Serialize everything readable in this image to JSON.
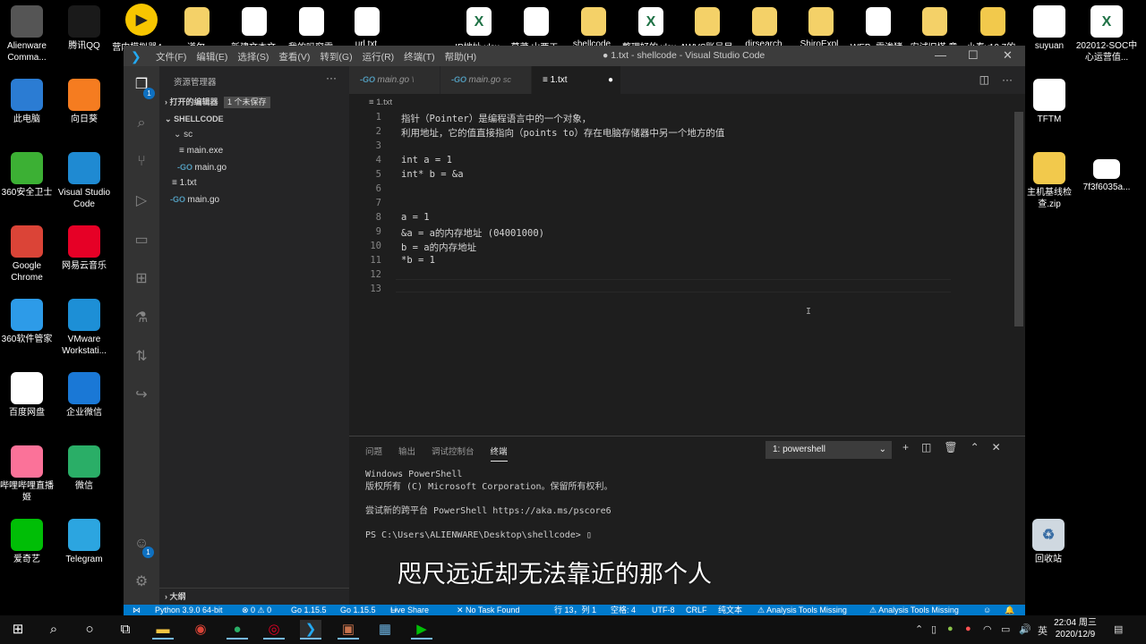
{
  "desktop": {
    "top_labels": [
      "营内模拟器4",
      "道尔",
      "新建文本文",
      "我的吗窗需",
      "url.txt",
      "IP地址.xlsx",
      "草莽 山两工",
      "shellcode",
      "整理好的.xlsx",
      "AWVS账号目",
      "dirsearch",
      "ShiroExpl",
      "WEB_需渗猪",
      "安试旧塔 意",
      "小泰v10.7的"
    ],
    "left_icons": [
      {
        "label": "Alienware Comma...",
        "icon": "alien-icon",
        "color": "#555"
      },
      {
        "label": "腾讯QQ",
        "icon": "qq-icon",
        "color": "#1a1a1a"
      },
      {
        "label": "此电脑",
        "icon": "computer-icon",
        "color": "#2b7cd3"
      },
      {
        "label": "向日葵",
        "icon": "sunflower-icon",
        "color": "#f57c20"
      },
      {
        "label": "360安全卫士",
        "icon": "360-icon",
        "color": "#3cb034"
      },
      {
        "label": "Visual Studio Code",
        "icon": "vscode-icon",
        "color": "#1f8ad2"
      },
      {
        "label": "Google Chrome",
        "icon": "chrome-icon",
        "color": "#db4437"
      },
      {
        "label": "网易云音乐",
        "icon": "netease-icon",
        "color": "#e60026"
      },
      {
        "label": "360软件管家",
        "icon": "360soft-icon",
        "color": "#2d9be8"
      },
      {
        "label": "VMware Workstati...",
        "icon": "vmware-icon",
        "color": "#1d8fd6"
      },
      {
        "label": "百度网盘",
        "icon": "baidu-icon",
        "color": "#fff"
      },
      {
        "label": "企业微信",
        "icon": "wecom-icon",
        "color": "#1a78d6"
      },
      {
        "label": "哔哩哔哩直播姬",
        "icon": "bilibili-icon",
        "color": "#fb7299"
      },
      {
        "label": "微信",
        "icon": "wechat-icon",
        "color": "#2aae67"
      },
      {
        "label": "爱奇艺",
        "icon": "iqiyi-icon",
        "color": "#00be06"
      },
      {
        "label": "Telegram",
        "icon": "telegram-icon",
        "color": "#2ca5e0"
      }
    ],
    "right_icons": [
      {
        "label": "suyuan",
        "icon": "word-icon"
      },
      {
        "label": "202012-SOC中心运营值...",
        "icon": "excel-icon"
      },
      {
        "label": "TFTM",
        "icon": "word-icon"
      },
      {
        "label": "主机基线检查.zip",
        "icon": "zip-icon"
      },
      {
        "label": "7f3f6035a...",
        "icon": "file-icon"
      },
      {
        "label": "回收站",
        "icon": "recycle-bin-icon"
      }
    ]
  },
  "window": {
    "menu": [
      "文件(F)",
      "编辑(E)",
      "选择(S)",
      "查看(V)",
      "转到(G)",
      "运行(R)",
      "终端(T)",
      "帮助(H)"
    ],
    "title": "● 1.txt - shellcode - Visual Studio Code"
  },
  "activity_badges": {
    "explorer": "1",
    "account": "1"
  },
  "sidebar": {
    "header": "资源管理器",
    "open_editors": "打开的编辑器",
    "unsaved": "1 个未保存",
    "folder": "SHELLCODE",
    "tree": [
      {
        "label": "sc",
        "kind": "folder"
      },
      {
        "label": "main.exe",
        "kind": "file"
      },
      {
        "label": "main.go",
        "kind": "go"
      },
      {
        "label": "1.txt",
        "kind": "file"
      },
      {
        "label": "main.go",
        "kind": "go"
      }
    ],
    "outline": "大纲"
  },
  "tabs": [
    {
      "label": "main.go",
      "hint": "\\"
    },
    {
      "label": "main.go",
      "hint": "sc"
    },
    {
      "label": "1.txt",
      "hint": "●"
    }
  ],
  "breadcrumb": "1.txt",
  "editor": {
    "lines": [
      "指针（Pointer）是编程语言中的一个对象，",
      "利用地址，它的值直接指向（points to）存在电脑存储器中另一个地方的值",
      "",
      "int a = 1",
      "int* b = &a",
      "",
      "",
      "a = 1",
      "&a = a的内存地址 (04001000)",
      "b = a的内存地址",
      "*b = 1",
      "",
      ""
    ]
  },
  "panel": {
    "tabs": [
      "问题",
      "输出",
      "调试控制台",
      "终端"
    ],
    "terminal_select": "1: powershell",
    "terminal_lines": [
      "Windows PowerShell",
      "版权所有 (C) Microsoft Corporation。保留所有权利。",
      "",
      "尝试新的跨平台 PowerShell https://aka.ms/pscore6",
      "",
      "PS C:\\Users\\ALIENWARE\\Desktop\\shellcode> ▯"
    ]
  },
  "subtitle": "咫尺远近却无法靠近的那个人",
  "statusbar": {
    "python": "Python 3.9.0 64-bit",
    "problems": "⊗ 0 ⚠ 0",
    "go1": "Go 1.15.5",
    "go2": "Go 1.15.5",
    "liveshare": "Live Share",
    "task": "✕ No Task Found",
    "position": "行 13，列 1",
    "spaces": "空格: 4",
    "encoding": "UTF-8",
    "eol": "CRLF",
    "language": "纯文本",
    "analysis1": "⚠ Analysis Tools Missing",
    "analysis2": "⚠ Analysis Tools Missing"
  },
  "taskbar": {
    "ime": "英",
    "time": "22:04 周三",
    "date": "2020/12/9"
  }
}
